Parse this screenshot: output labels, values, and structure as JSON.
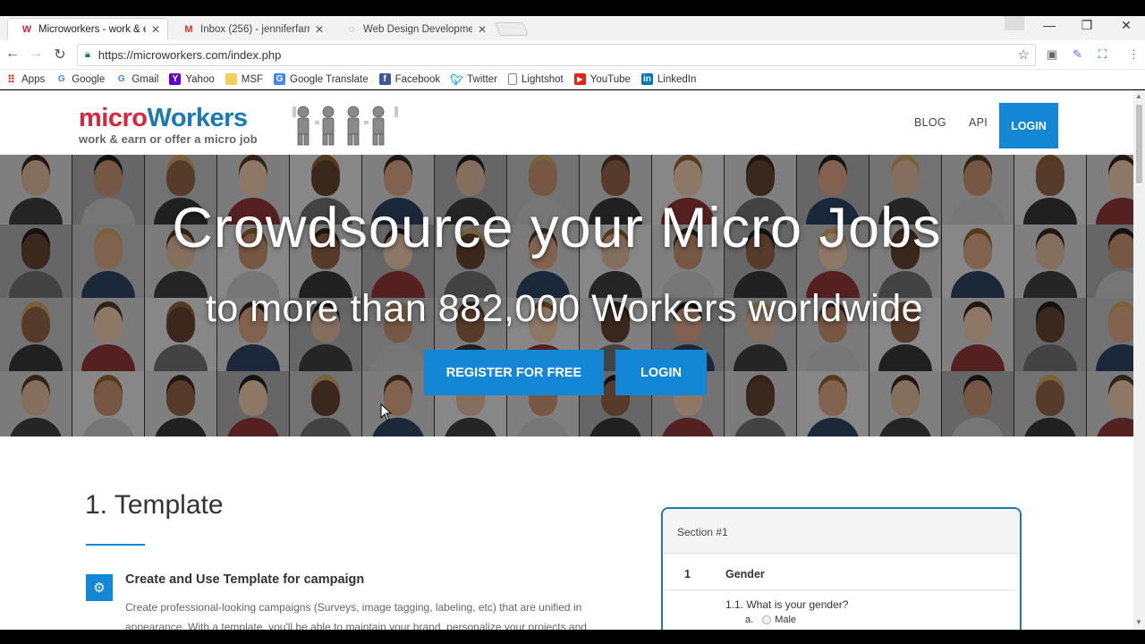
{
  "browser": {
    "tabs": [
      {
        "favicon": "W",
        "title": "Microworkers - work & e",
        "active": true
      },
      {
        "favicon": "M",
        "title": "Inbox (256) - jenniferfarr",
        "active": false
      },
      {
        "favicon": "◌",
        "title": "Web Design Developme",
        "active": false
      }
    ],
    "url": "https://microworkers.com/index.php",
    "bookmarks": [
      {
        "icon": "apps-icon",
        "label": "Apps"
      },
      {
        "icon": "google-icon",
        "label": "Google"
      },
      {
        "icon": "google-icon",
        "label": "Gmail"
      },
      {
        "icon": "yahoo-icon",
        "label": "Yahoo"
      },
      {
        "icon": "folder-icon",
        "label": "MSF"
      },
      {
        "icon": "translate-icon",
        "label": "Google Translate"
      },
      {
        "icon": "facebook-icon",
        "label": "Facebook"
      },
      {
        "icon": "twitter-icon",
        "label": "Twitter"
      },
      {
        "icon": "page-icon",
        "label": "Lightshot"
      },
      {
        "icon": "youtube-icon",
        "label": "YouTube"
      },
      {
        "icon": "linkedin-icon",
        "label": "LinkedIn"
      }
    ]
  },
  "site": {
    "logo": {
      "micro": "micro",
      "workers": "Workers",
      "tagline": "work & earn or offer a micro job"
    },
    "nav": {
      "blog": "BLOG",
      "api": "API",
      "login": "LOGIN"
    },
    "hero": {
      "title": "Crowdsource your Micro Jobs",
      "subtitle": "to more than 882,000 Workers worldwide",
      "register_button": "REGISTER FOR FREE",
      "login_button": "LOGIN"
    },
    "section": {
      "title": "1. Template",
      "feature_title": "Create and Use Template for campaign",
      "feature_desc": "Create professional-looking campaigns (Surveys, image tagging, labeling, etc) that are unified in appearance. With a template, you'll be able to maintain your brand, personalize your projects and"
    },
    "survey": {
      "section_label": "Section #1",
      "question_number": "1",
      "question_label": "Gender",
      "sub_question": "1.1. What is your gender?",
      "option_letter": "a.",
      "option_label": "Male"
    }
  },
  "colors": {
    "accent": "#1387d6",
    "logo_red": "#d9263a",
    "logo_blue": "#1a7ab6"
  }
}
